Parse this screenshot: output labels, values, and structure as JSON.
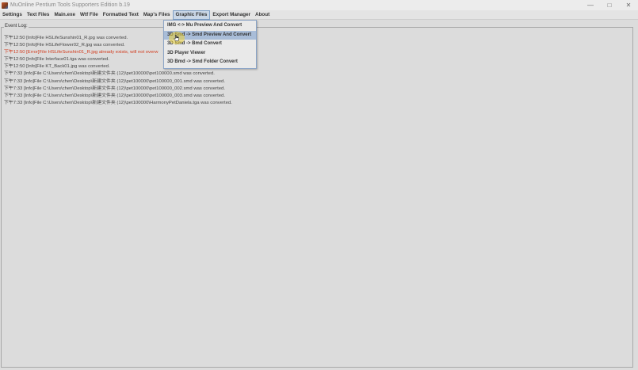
{
  "window": {
    "title": "MuOnline Pentium Tools Supporters Edition b.19",
    "minimize_glyph": "—",
    "maximize_glyph": "□",
    "close_glyph": "✕"
  },
  "menubar": {
    "items": [
      {
        "label": "Settings"
      },
      {
        "label": "Text Files"
      },
      {
        "label": "Main.exe"
      },
      {
        "label": "Wtf File"
      },
      {
        "label": "Formatted Text"
      },
      {
        "label": "Map's Files"
      },
      {
        "label": "Graphic Files"
      },
      {
        "label": "Export Manager"
      },
      {
        "label": "About"
      }
    ]
  },
  "graphic_files_menu": {
    "items": [
      {
        "label": "IMG <-> Mu Preview And Convert"
      },
      {
        "label": "3D Smd -> Smd Preview And Convert"
      },
      {
        "label": "3D Smd -> Bmd Convert"
      },
      {
        "label": "3D Player Viewer"
      },
      {
        "label": "3D Bmd -> Smd Folder Convert"
      }
    ]
  },
  "event_log": {
    "title": "Event Log:",
    "lines": [
      {
        "text": "下午12:50 [Info]File HSLifeSunshin01_R.jpg was converted."
      },
      {
        "text": "下午12:50 [Info]File HSLifeFlower02_R.jpg was converted."
      },
      {
        "text": "下午12:50 [Error]File HSLifeSunshin01_R.jpg already exists, will not overw"
      },
      {
        "text": "下午12:50 [Info]File Interface01.tga was converted."
      },
      {
        "text": "下午12:50 [Info]File KT_Back01.jpg was converted."
      },
      {
        "text": "下午7:33 [Info]File C:\\Users\\chen\\Desktop\\新建文件夹 (12)\\pet100000\\pet100000.smd was converted."
      },
      {
        "text": "下午7:33 [Info]File C:\\Users\\chen\\Desktop\\新建文件夹 (12)\\pet100000\\pet100000_001.smd was converted."
      },
      {
        "text": "下午7:33 [Info]File C:\\Users\\chen\\Desktop\\新建文件夹 (12)\\pet100000\\pet100000_002.smd was converted."
      },
      {
        "text": "下午7:33 [Info]File C:\\Users\\chen\\Desktop\\新建文件夹 (12)\\pet100000\\pet100000_003.smd was converted."
      },
      {
        "text": "下午7:33 [Info]File C:\\Users\\chen\\Desktop\\新建文件夹 (12)\\pet100000\\HarmonyPetDaniela.tga was converted."
      }
    ]
  },
  "colors": {
    "error_text": "#d23c1e",
    "menu_highlight": "#a9bdd8",
    "cursor_halo": "#ebd23c"
  }
}
